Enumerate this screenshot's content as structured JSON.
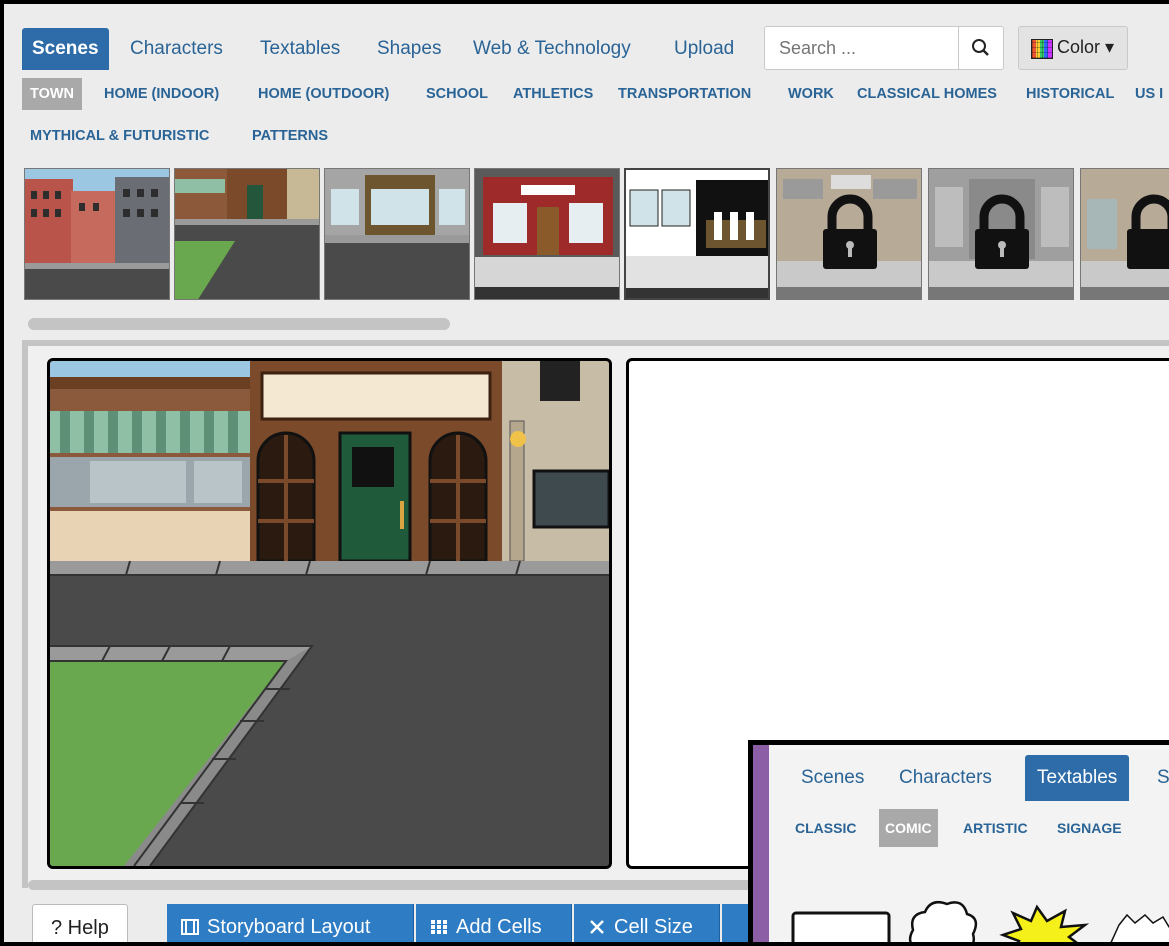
{
  "nav": {
    "tabs": [
      {
        "label": "Scenes",
        "active": true
      },
      {
        "label": "Characters",
        "active": false
      },
      {
        "label": "Textables",
        "active": false
      },
      {
        "label": "Shapes",
        "active": false
      },
      {
        "label": "Web & Technology",
        "active": false
      },
      {
        "label": "Upload",
        "active": false
      }
    ],
    "search_placeholder": "Search ...",
    "search_icon": "magnifier-icon",
    "color_label": "Color",
    "color_caret": "▾"
  },
  "categories": [
    "TOWN",
    "HOME (INDOOR)",
    "HOME (OUTDOOR)",
    "SCHOOL",
    "ATHLETICS",
    "TRANSPORTATION",
    "WORK",
    "CLASSICAL HOMES",
    "HISTORICAL",
    "US I",
    "MYTHICAL & FUTURISTIC",
    "PATTERNS"
  ],
  "active_category": "TOWN",
  "thumbnails": [
    {
      "name": "row-houses",
      "locked": false
    },
    {
      "name": "street-corner",
      "locked": false
    },
    {
      "name": "shop-front",
      "locked": false
    },
    {
      "name": "red-store",
      "locked": false
    },
    {
      "name": "ice-cream-shop",
      "locked": false
    },
    {
      "name": "awning-shop",
      "locked": true
    },
    {
      "name": "storefront",
      "locked": true
    },
    {
      "name": "shop-partial",
      "locked": true
    }
  ],
  "bottom_bar": {
    "help": "? Help",
    "storyboard_layout": "Storyboard Layout",
    "add_cells": "Add Cells",
    "cell_size": "Cell Size"
  },
  "inset": {
    "tabs": [
      {
        "label": "Scenes",
        "active": false
      },
      {
        "label": "Characters",
        "active": false
      },
      {
        "label": "Textables",
        "active": true
      },
      {
        "label": "Sh",
        "active": false
      }
    ],
    "categories": [
      "CLASSIC",
      "COMIC",
      "ARTISTIC",
      "SIGNAGE"
    ],
    "active_category": "COMIC"
  },
  "colors": {
    "accent": "#2d6ca8",
    "link": "#2a6496",
    "purple": "#8c5ea6"
  }
}
